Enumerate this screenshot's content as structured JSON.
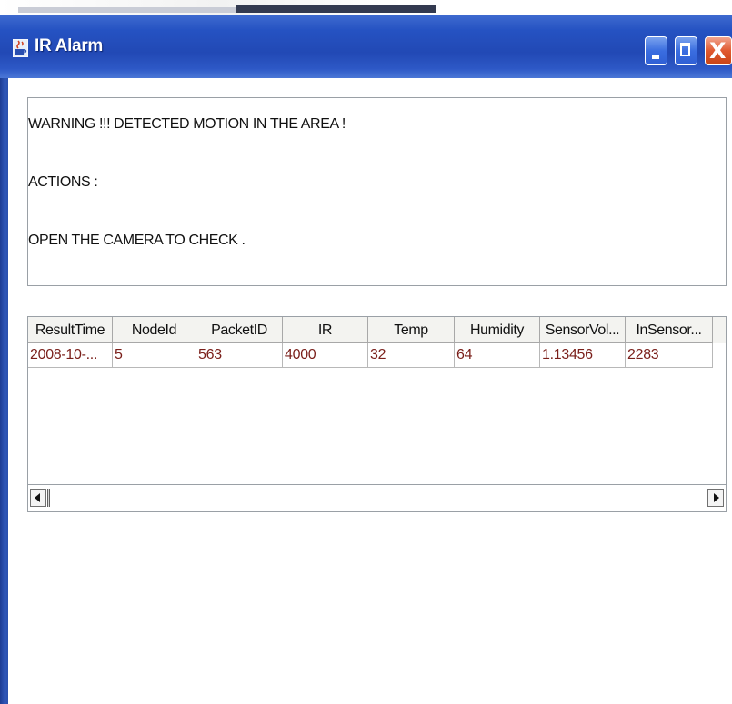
{
  "window": {
    "title": "IR Alarm",
    "app_icon": "java-cup-icon",
    "controls": {
      "minimize_icon": "minimize-icon",
      "maximize_icon": "maximize-icon",
      "close_icon": "close-icon",
      "close_glyph": "X"
    },
    "colors": {
      "titlebar": "#2552c2",
      "close_button": "#e0592f",
      "cell_text": "#7a1f1a"
    }
  },
  "message": {
    "lines": [
      "WARNING !!! DETECTED MOTION IN THE AREA !",
      "ACTIONS :",
      "OPEN THE CAMERA TO CHECK  ."
    ]
  },
  "table": {
    "columns": [
      "ResultTime",
      "NodeId",
      "PacketID",
      "IR",
      "Temp",
      "Humidity",
      "SensorVol...",
      "InSensor..."
    ],
    "rows": [
      [
        "2008-10-...",
        "5",
        "563",
        "4000",
        "32",
        "64",
        "1.13456",
        "2283"
      ]
    ]
  },
  "scrollbar": {
    "left_icon": "scroll-left-arrow-icon",
    "right_icon": "scroll-right-arrow-icon"
  }
}
